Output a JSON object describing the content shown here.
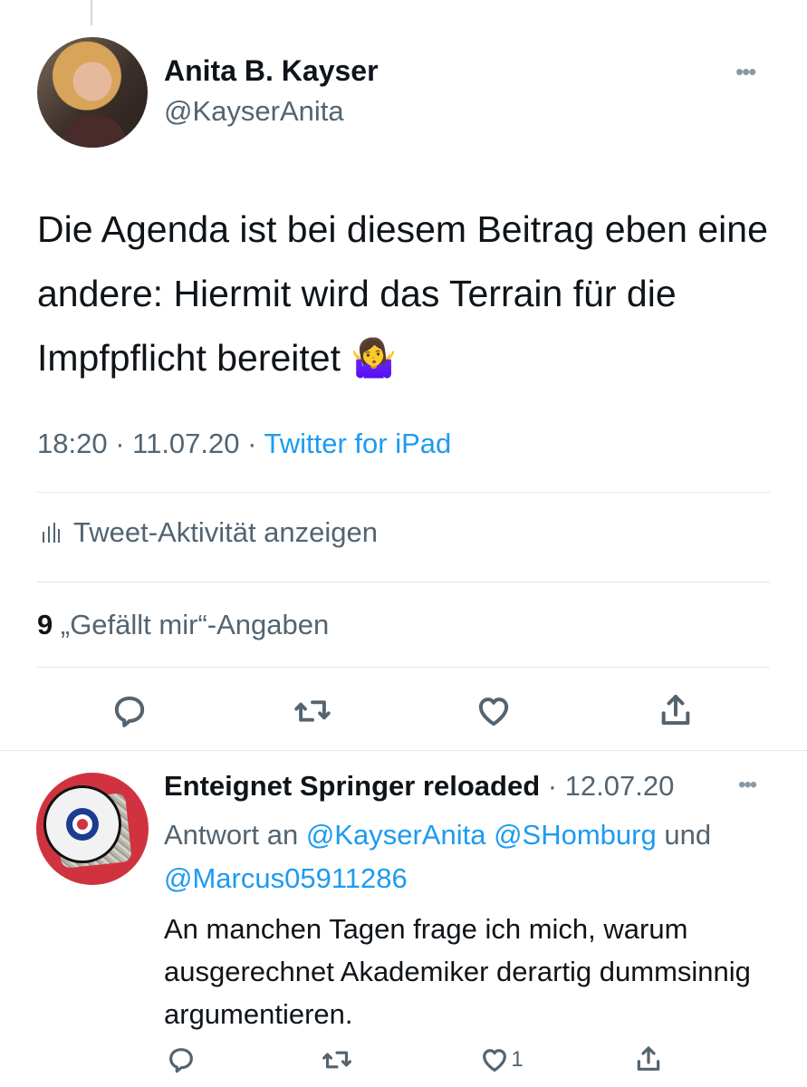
{
  "tweet": {
    "author": {
      "name": "Anita B. Kayser",
      "handle": "@KayserAnita"
    },
    "more_label": "•••",
    "text": "Die Agenda ist bei diesem Beitrag eben eine andere: Hiermit wird das Terrain für die Impfpflicht bereitet",
    "emoji": "🤷‍♀️",
    "time": "18:20",
    "date": "11.07.20",
    "separator": " · ",
    "source": "Twitter for iPad",
    "activity_label": "Tweet-Aktivität anzeigen",
    "likes_count": "9",
    "likes_label": "„Gefällt mir“-Angaben"
  },
  "reply": {
    "author_name": "Enteignet Springer reloaded",
    "date": "12.07.20",
    "separator": " · ",
    "more_label": "•••",
    "reply_to_prefix": "Antwort an",
    "mentions": [
      "@KayserAnita",
      "@SHomburg",
      "@Marcus05911286"
    ],
    "and_word": "und",
    "text": "An manchen Tagen frage ich mich, warum ausgerechnet Akademiker derartig dummsinnig argumentieren.",
    "like_count": "1",
    "avatar_badge_text": "Enteignet Springer"
  },
  "icons": {
    "reply": "speech-bubble-icon",
    "retweet": "retweet-icon",
    "like": "heart-icon",
    "share": "share-icon",
    "activity": "bar-chart-icon"
  },
  "colors": {
    "text": "#0f1419",
    "secondary": "#536471",
    "link": "#1d9bf0",
    "divider": "#e1e8ed"
  }
}
